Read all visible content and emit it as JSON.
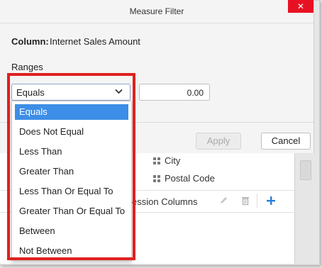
{
  "dialog": {
    "title": "Measure Filter",
    "close_glyph": "✕",
    "column_label": "Column:",
    "column_value": "Internet Sales Amount",
    "ranges_label": "Ranges",
    "condition_selected": "Equals",
    "value_input": "0.00",
    "apply_label": "Apply",
    "cancel_label": "Cancel"
  },
  "dropdown": {
    "options": [
      "Equals",
      "Does Not Equal",
      "Less Than",
      "Greater Than",
      "Less Than Or Equal To",
      "Greater Than Or Equal To",
      "Between",
      "Not Between"
    ],
    "selected_index": 0
  },
  "background": {
    "fields": [
      "City",
      "Postal Code"
    ],
    "section_title": "ession Columns"
  },
  "colors": {
    "accent": "#3d8ee6",
    "highlight": "#e02020",
    "close": "#e81123"
  },
  "icons": [
    "chevron-down-icon",
    "close-icon",
    "grid-icon",
    "edit-icon",
    "trash-icon",
    "add-icon"
  ]
}
